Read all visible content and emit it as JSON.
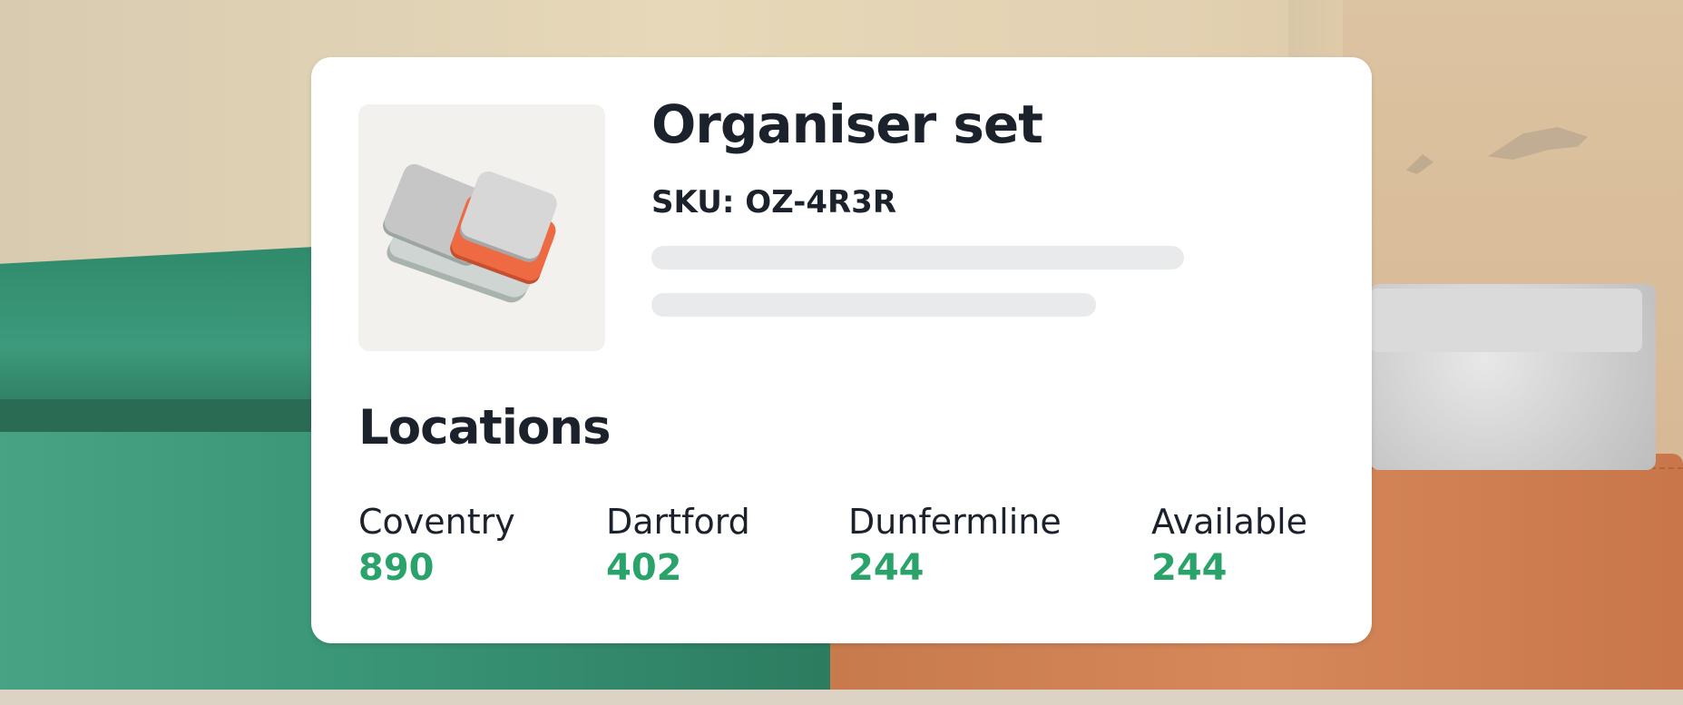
{
  "product": {
    "name": "Organiser set",
    "sku": "SKU: OZ-4R3R",
    "image_icon": "organiser-trays-image"
  },
  "locations": {
    "heading": "Locations",
    "items": [
      {
        "name": "Coventry",
        "value": "890"
      },
      {
        "name": "Dartford",
        "value": "402"
      },
      {
        "name": "Dunfermline",
        "value": "244"
      },
      {
        "name": "Available",
        "value": "244"
      }
    ]
  },
  "colors": {
    "text": "#1b222c",
    "value_green": "#2aa36a",
    "card_bg": "#ffffff",
    "skeleton": "#e9eaeb"
  }
}
